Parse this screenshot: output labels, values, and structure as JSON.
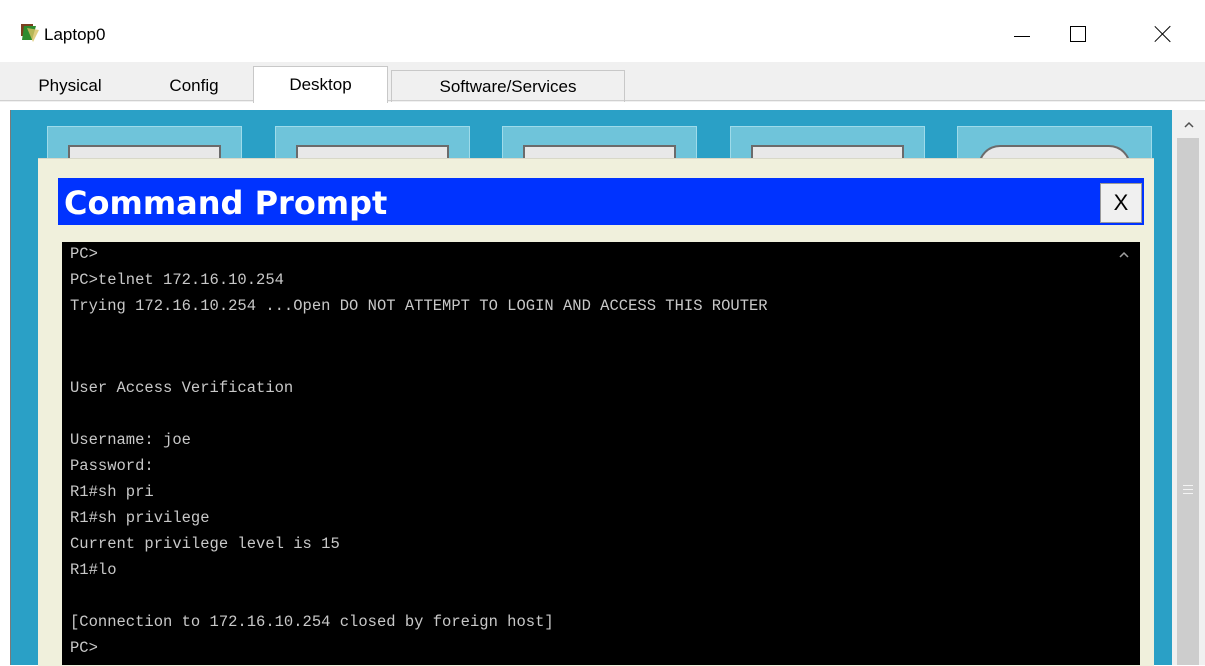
{
  "window": {
    "title": "Laptop0",
    "minimize_label": "—",
    "close_label": "✕"
  },
  "tabs": [
    {
      "label": "Physical",
      "active": false
    },
    {
      "label": "Config",
      "active": false
    },
    {
      "label": "Desktop",
      "active": true
    },
    {
      "label": "Software/Services",
      "active": false
    }
  ],
  "command_prompt": {
    "title": "Command Prompt",
    "close_label": "X",
    "lines": [
      "PC>",
      "PC>telnet 172.16.10.254",
      "Trying 172.16.10.254 ...Open DO NOT ATTEMPT TO LOGIN AND ACCESS THIS ROUTER",
      "",
      "",
      "User Access Verification",
      "",
      "Username: joe",
      "Password:",
      "R1#sh pri",
      "R1#sh privilege",
      "Current privilege level is 15",
      "R1#lo",
      "",
      "[Connection to 172.16.10.254 closed by foreign host]",
      "PC>"
    ]
  },
  "colors": {
    "desktop_bg": "#2aa0c6",
    "cmd_titlebar": "#0033ff",
    "terminal_bg": "#000000",
    "terminal_text": "#c8c8c8"
  }
}
